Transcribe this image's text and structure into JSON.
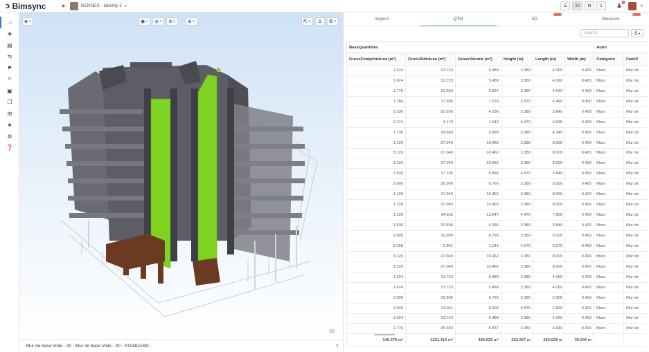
{
  "header": {
    "logo_text": "Bimsync",
    "project_name": "RENNES - Identity 2",
    "view_toggle": [
      "30",
      "1"
    ],
    "notification_count": "2"
  },
  "viewport": {
    "label_2d": "2D",
    "status_text": "- Mur de base:Voile - 40 - Mur de base:Voile - 40 - STANDARD",
    "close_glyph": "×"
  },
  "panel": {
    "tabs": [
      {
        "label": "Inspect"
      },
      {
        "label": "QTO"
      },
      {
        "label": "4D"
      },
      {
        "label": "Measure"
      }
    ],
    "search_placeholder": "Search",
    "table": {
      "group_headers": [
        "BaseQuantities",
        "Autre"
      ],
      "columns": [
        "GrossFootprintArea (m²)",
        "GrossSideArea (m²)",
        "GrossVolume (m³)",
        "Height (m)",
        "Length (m)",
        "Width (m)",
        "Catégorie",
        "Famill"
      ],
      "rows": [
        [
          "1.624",
          "13.723",
          "5.489",
          "3.380",
          "4.060",
          "0.400",
          "Murs",
          "Mur de"
        ],
        [
          "1.624",
          "13.723",
          "5.489",
          "3.380",
          "4.060",
          "0.400",
          "Murs",
          "Mur de"
        ],
        [
          "1.776",
          "15.683",
          "5.837",
          "3.380",
          "4.640",
          "0.400",
          "Murs",
          "Mur de"
        ],
        [
          "1.784",
          "17.686",
          "7.074",
          "3.970",
          "4.460",
          "0.400",
          "Murs",
          "Mur de"
        ],
        [
          "1.536",
          "10.590",
          "4.236",
          "3.380",
          "3.840",
          "0.400",
          "Murs",
          "Mur de"
        ],
        [
          "0.374",
          "4.179",
          "1.642",
          "4.470",
          "0.935",
          "0.400",
          "Murs",
          "Mur de"
        ],
        [
          "1.736",
          "14.669",
          "5.868",
          "3.380",
          "4.340",
          "0.400",
          "Murs",
          "Mur de"
        ],
        [
          "3.120",
          "27.040",
          "10.462",
          "3.380",
          "8.000",
          "0.400",
          "Murs",
          "Mur de"
        ],
        [
          "3.120",
          "27.040",
          "10.462",
          "3.380",
          "8.000",
          "0.400",
          "Murs",
          "Mur de"
        ],
        [
          "3.120",
          "27.040",
          "10.462",
          "3.380",
          "8.000",
          "0.400",
          "Murs",
          "Mur de"
        ],
        [
          "1.536",
          "17.165",
          "6.866",
          "4.470",
          "3.840",
          "0.400",
          "Murs",
          "Mur de"
        ],
        [
          "2.000",
          "16.900",
          "6.760",
          "3.380",
          "5.000",
          "0.400",
          "Murs",
          "Mur de"
        ],
        [
          "3.120",
          "27.040",
          "10.462",
          "3.380",
          "8.000",
          "0.400",
          "Murs",
          "Mur de"
        ],
        [
          "3.120",
          "27.040",
          "10.462",
          "3.380",
          "8.000",
          "0.400",
          "Murs",
          "Mur de"
        ],
        [
          "3.120",
          "34.655",
          "13.647",
          "4.470",
          "7.800",
          "0.400",
          "Murs",
          "Mur de"
        ],
        [
          "1.536",
          "10.590",
          "4.236",
          "3.380",
          "3.840",
          "0.400",
          "Murs",
          "Mur de"
        ],
        [
          "2.000",
          "16.900",
          "6.760",
          "3.380",
          "5.000",
          "0.400",
          "Murs",
          "Mur de"
        ],
        [
          "0.268",
          "2.861",
          "1.144",
          "4.270",
          "0.670",
          "0.400",
          "Murs",
          "Mur de"
        ],
        [
          "3.120",
          "27.040",
          "10.462",
          "3.380",
          "8.000",
          "0.400",
          "Murs",
          "Mur de"
        ],
        [
          "3.120",
          "27.040",
          "10.462",
          "3.380",
          "8.000",
          "0.400",
          "Murs",
          "Mur de"
        ],
        [
          "1.624",
          "13.723",
          "5.489",
          "3.380",
          "4.060",
          "0.400",
          "Murs",
          "Mur de"
        ],
        [
          "1.624",
          "13.723",
          "5.489",
          "3.380",
          "4.060",
          "0.400",
          "Murs",
          "Mur de"
        ],
        [
          "2.000",
          "16.900",
          "6.760",
          "3.380",
          "5.000",
          "0.400",
          "Murs",
          "Mur de"
        ],
        [
          "1.000",
          "13.061",
          "5.204",
          "5.875",
          "2.500",
          "0.400",
          "Murs",
          "Mur de"
        ],
        [
          "1.624",
          "13.723",
          "5.489",
          "3.380",
          "4.060",
          "0.400",
          "Murs",
          "Mur de"
        ],
        [
          "1.776",
          "15.683",
          "5.837",
          "3.380",
          "4.640",
          "0.400",
          "Murs",
          "Mur de"
        ]
      ],
      "totals": [
        "146.376 m²",
        "1231.410 m²",
        "484.625 m³",
        "262.067 m",
        "369.528 m",
        "30.000 m",
        "",
        ""
      ]
    }
  },
  "colors": {
    "accent": "#2b7cd3",
    "selected_green": "#7ed321",
    "structure_gray": "#5a5a60",
    "foundation_brown": "#6b3a22"
  }
}
